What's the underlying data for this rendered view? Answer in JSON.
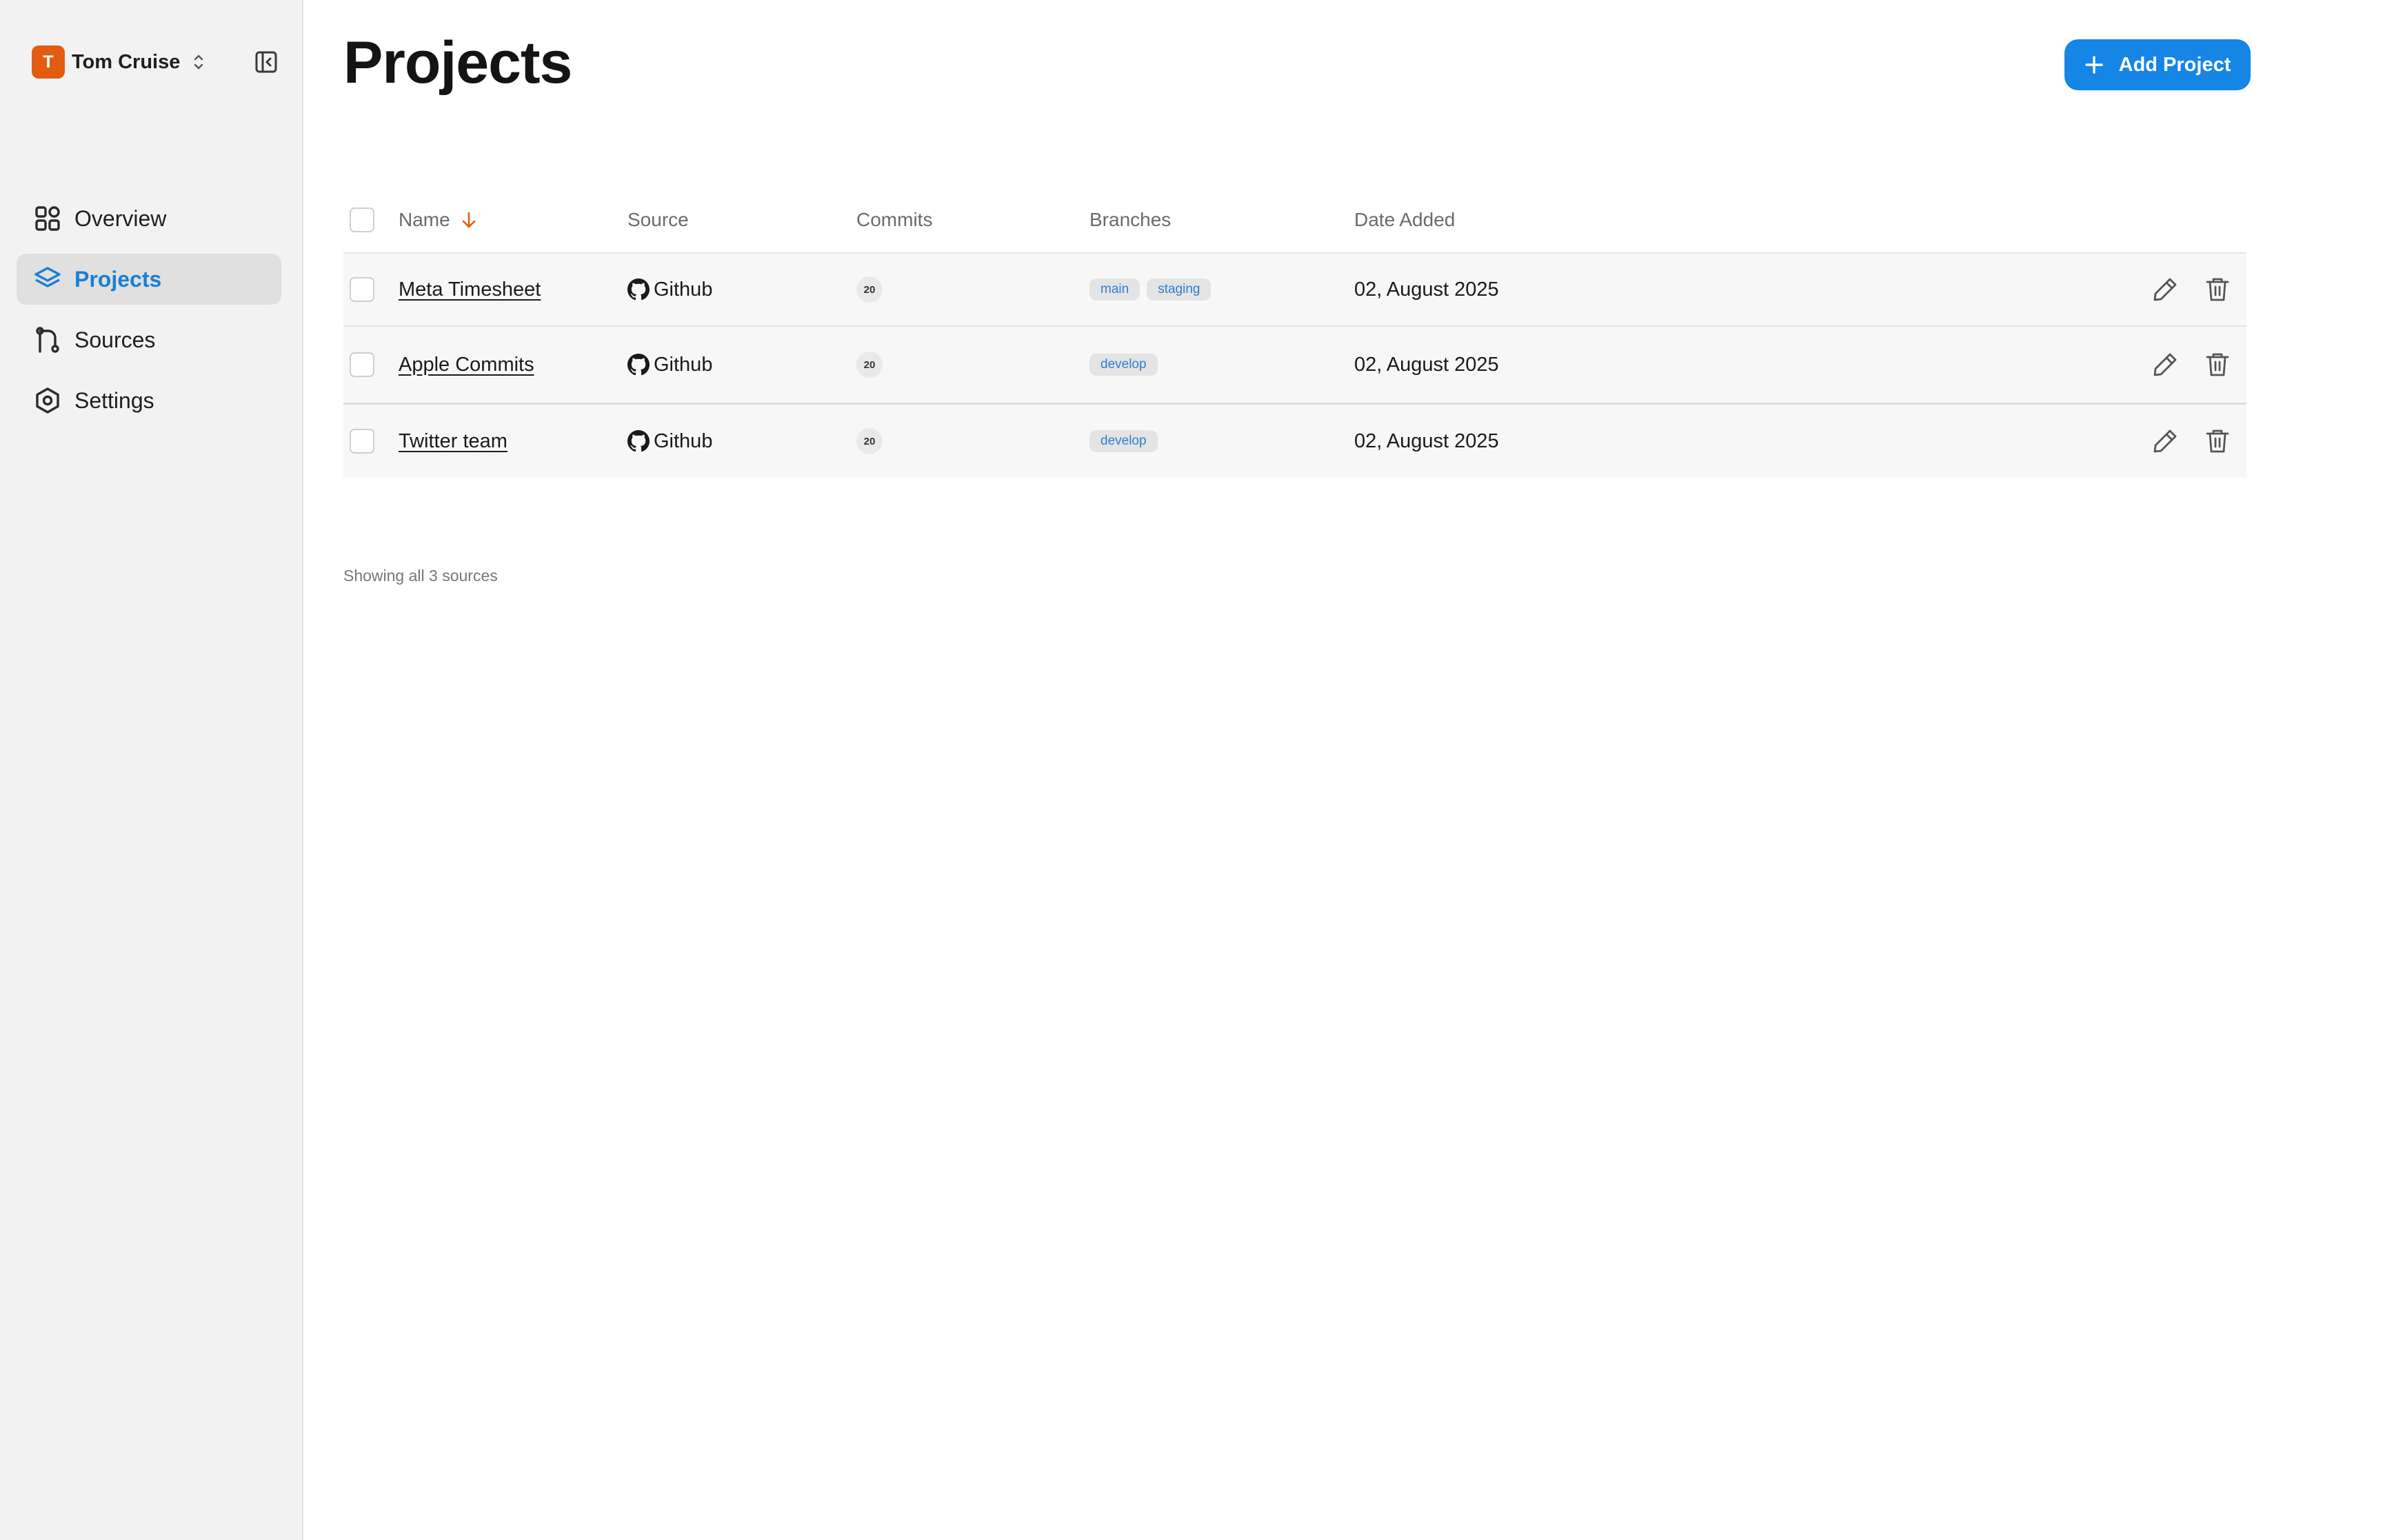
{
  "user": {
    "initial": "T",
    "name": "Tom Cruise",
    "avatar_color": "#e25c12"
  },
  "nav": {
    "items": [
      {
        "label": "Overview",
        "icon": "grid-icon"
      },
      {
        "label": "Projects",
        "icon": "layers-icon",
        "active": true
      },
      {
        "label": "Sources",
        "icon": "git-branch-icon"
      },
      {
        "label": "Settings",
        "icon": "settings-hexagon-icon"
      }
    ]
  },
  "page": {
    "title": "Projects",
    "add_button_label": "Add Project",
    "accent_color": "#1585e6"
  },
  "table": {
    "headers": {
      "name": "Name",
      "source": "Source",
      "commits": "Commits",
      "branches": "Branches",
      "date_added": "Date Added"
    },
    "sort": {
      "column": "Name",
      "direction": "descending",
      "indicator_color": "#e25c12"
    },
    "rows": [
      {
        "name": "Meta Timesheet",
        "source": "Github",
        "commits": "20",
        "branches": [
          "main",
          "staging"
        ],
        "date": "02, August 2025"
      },
      {
        "name": "Apple Commits",
        "source": "Github",
        "commits": "20",
        "branches": [
          "develop"
        ],
        "date": "02, August 2025"
      },
      {
        "name": "Twitter team",
        "source": "Github",
        "commits": "20",
        "branches": [
          "develop"
        ],
        "date": "02, August 2025"
      }
    ]
  },
  "footer": {
    "text": "Showing all 3 sources"
  }
}
